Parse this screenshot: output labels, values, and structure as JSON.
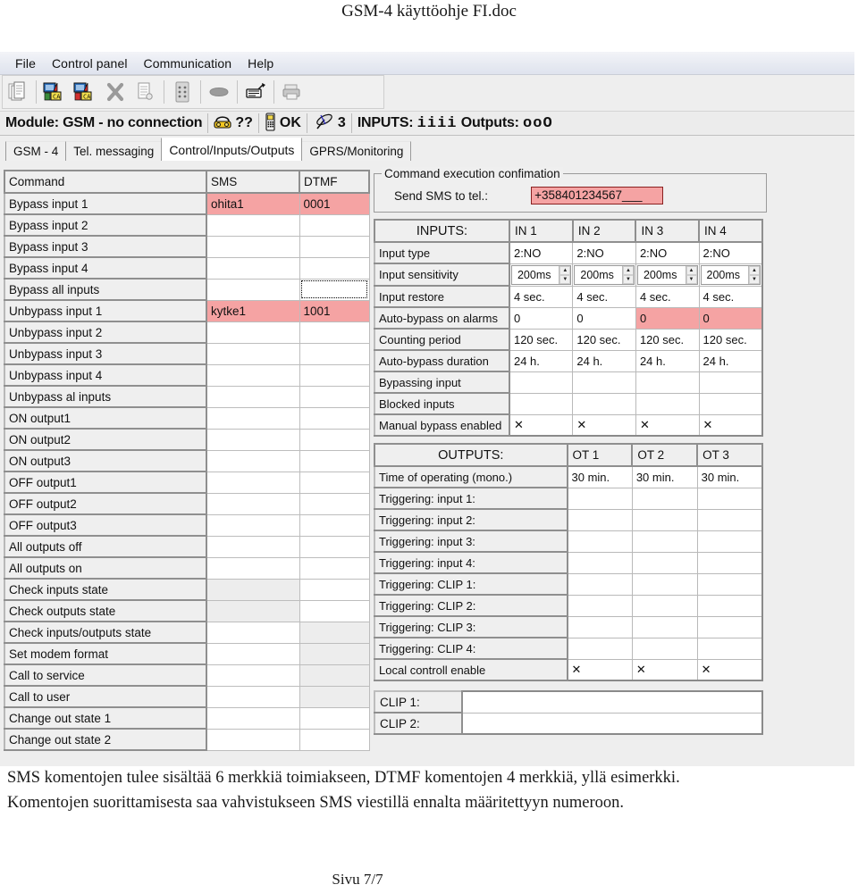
{
  "document": {
    "header_title": "GSM-4 käyttöohje FI.doc",
    "body_lines": [
      "SMS komentojen tulee sisältää 6 merkkiä toimiakseen, DTMF komentojen 4 merkkiä, yllä esimerkki.",
      "Komentojen suorittamisesta saa vahvistukseen SMS viestillä ennalta määritettyyn numeroon."
    ],
    "footer": "Sivu 7/7"
  },
  "app": {
    "menubar": [
      "File",
      "Control panel",
      "Communication",
      "Help"
    ],
    "toolbar": [
      {
        "name": "new-document-icon",
        "title": "New"
      },
      {
        "name": "download-from-module-icon",
        "title": "Read"
      },
      {
        "name": "upload-to-module-icon",
        "title": "Write"
      },
      {
        "name": "delete-icon",
        "title": "Delete"
      },
      {
        "name": "copy-document-icon",
        "title": "Copy"
      },
      {
        "name": "keypad-icon",
        "title": "Keypad"
      },
      {
        "name": "connect-icon",
        "title": "Connect"
      },
      {
        "name": "modem-icon",
        "title": "Modem"
      },
      {
        "name": "print-icon",
        "title": "Print"
      }
    ],
    "statusbar": {
      "module_label": "Module: GSM - no connection",
      "phone_status": "??",
      "sim_status": "OK",
      "signal_level": "3",
      "inputs_label": "INPUTS:",
      "inputs_state": "iiii",
      "outputs_label": "Outputs:",
      "outputs_state": "ooO"
    },
    "tabs": [
      {
        "label": "GSM - 4",
        "active": false
      },
      {
        "label": "Tel. messaging",
        "active": false
      },
      {
        "label": "Control/Inputs/Outputs",
        "active": true
      },
      {
        "label": "GPRS/Monitoring",
        "active": false
      }
    ]
  },
  "command_table": {
    "headers": [
      "Command",
      "SMS",
      "DTMF"
    ],
    "rows": [
      {
        "command": "Bypass input 1",
        "sms": "ohita1",
        "dtmf": "0001",
        "sms_state": "highlight",
        "dtmf_state": "highlight"
      },
      {
        "command": "Bypass input 2",
        "sms": "",
        "dtmf": "",
        "sms_state": "normal",
        "dtmf_state": "normal"
      },
      {
        "command": "Bypass input 3",
        "sms": "",
        "dtmf": "",
        "sms_state": "normal",
        "dtmf_state": "normal"
      },
      {
        "command": "Bypass input 4",
        "sms": "",
        "dtmf": "",
        "sms_state": "normal",
        "dtmf_state": "normal"
      },
      {
        "command": "Bypass all inputs",
        "sms": "",
        "dtmf": "",
        "sms_state": "normal",
        "dtmf_state": "focus"
      },
      {
        "command": "Unbypass input 1",
        "sms": "kytke1",
        "dtmf": "1001",
        "sms_state": "highlight",
        "dtmf_state": "highlight"
      },
      {
        "command": "Unbypass input 2",
        "sms": "",
        "dtmf": "",
        "sms_state": "normal",
        "dtmf_state": "normal"
      },
      {
        "command": "Unbypass input 3",
        "sms": "",
        "dtmf": "",
        "sms_state": "normal",
        "dtmf_state": "normal"
      },
      {
        "command": "Unbypass input 4",
        "sms": "",
        "dtmf": "",
        "sms_state": "normal",
        "dtmf_state": "normal"
      },
      {
        "command": "Unbypass al inputs",
        "sms": "",
        "dtmf": "",
        "sms_state": "normal",
        "dtmf_state": "normal"
      },
      {
        "command": "ON output1",
        "sms": "",
        "dtmf": "",
        "sms_state": "normal",
        "dtmf_state": "normal"
      },
      {
        "command": "ON output2",
        "sms": "",
        "dtmf": "",
        "sms_state": "normal",
        "dtmf_state": "normal"
      },
      {
        "command": "ON output3",
        "sms": "",
        "dtmf": "",
        "sms_state": "normal",
        "dtmf_state": "normal"
      },
      {
        "command": "OFF output1",
        "sms": "",
        "dtmf": "",
        "sms_state": "normal",
        "dtmf_state": "normal"
      },
      {
        "command": "OFF output2",
        "sms": "",
        "dtmf": "",
        "sms_state": "normal",
        "dtmf_state": "normal"
      },
      {
        "command": "OFF output3",
        "sms": "",
        "dtmf": "",
        "sms_state": "normal",
        "dtmf_state": "normal"
      },
      {
        "command": "All outputs off",
        "sms": "",
        "dtmf": "",
        "sms_state": "normal",
        "dtmf_state": "normal"
      },
      {
        "command": "All outputs on",
        "sms": "",
        "dtmf": "",
        "sms_state": "normal",
        "dtmf_state": "normal"
      },
      {
        "command": "Check inputs state",
        "sms": "",
        "dtmf": "",
        "sms_state": "dim",
        "dtmf_state": "normal"
      },
      {
        "command": "Check outputs state",
        "sms": "",
        "dtmf": "",
        "sms_state": "dim",
        "dtmf_state": "normal"
      },
      {
        "command": "Check inputs/outputs state",
        "sms": "",
        "dtmf": "",
        "sms_state": "normal",
        "dtmf_state": "dim"
      },
      {
        "command": "Set modem format",
        "sms": "",
        "dtmf": "",
        "sms_state": "normal",
        "dtmf_state": "dim"
      },
      {
        "command": "Call to service",
        "sms": "",
        "dtmf": "",
        "sms_state": "normal",
        "dtmf_state": "dim"
      },
      {
        "command": "Call to user",
        "sms": "",
        "dtmf": "",
        "sms_state": "normal",
        "dtmf_state": "dim"
      },
      {
        "command": "Change out state 1",
        "sms": "",
        "dtmf": "",
        "sms_state": "normal",
        "dtmf_state": "normal"
      },
      {
        "command": "Change out state 2",
        "sms": "",
        "dtmf": "",
        "sms_state": "normal",
        "dtmf_state": "normal"
      }
    ]
  },
  "confirmation": {
    "group_title": "Command execution confimation",
    "field_label": "Send SMS to tel.:",
    "tel_value": "+358401234567___"
  },
  "inputs_table": {
    "title": "INPUTS:",
    "columns": [
      "IN 1",
      "IN 2",
      "IN 3",
      "IN 4"
    ],
    "rows": [
      {
        "label": "Input type",
        "values": [
          "2:NO",
          "2:NO",
          "2:NO",
          "2:NO"
        ],
        "kind": "text",
        "states": [
          "normal",
          "normal",
          "normal",
          "normal"
        ]
      },
      {
        "label": "Input sensitivity",
        "values": [
          "200ms",
          "200ms",
          "200ms",
          "200ms"
        ],
        "kind": "spin",
        "states": [
          "normal",
          "normal",
          "normal",
          "normal"
        ]
      },
      {
        "label": "Input restore",
        "values": [
          "4 sec.",
          "4 sec.",
          "4 sec.",
          "4 sec."
        ],
        "kind": "text",
        "states": [
          "normal",
          "normal",
          "normal",
          "normal"
        ]
      },
      {
        "label": "Auto-bypass on alarms",
        "values": [
          "0",
          "0",
          "0",
          "0"
        ],
        "kind": "text",
        "states": [
          "normal",
          "normal",
          "highlight",
          "highlight"
        ]
      },
      {
        "label": "Counting period",
        "values": [
          "120 sec.",
          "120 sec.",
          "120 sec.",
          "120 sec."
        ],
        "kind": "text",
        "states": [
          "normal",
          "normal",
          "normal",
          "normal"
        ]
      },
      {
        "label": "Auto-bypass duration",
        "values": [
          "24 h.",
          "24 h.",
          "24 h.",
          "24 h."
        ],
        "kind": "text",
        "states": [
          "normal",
          "normal",
          "normal",
          "normal"
        ]
      },
      {
        "label": "Bypassing input",
        "values": [
          "",
          "",
          "",
          ""
        ],
        "kind": "text",
        "states": [
          "normal",
          "normal",
          "normal",
          "normal"
        ]
      },
      {
        "label": "Blocked inputs",
        "values": [
          "",
          "",
          "",
          ""
        ],
        "kind": "text",
        "states": [
          "normal",
          "normal",
          "normal",
          "normal"
        ]
      },
      {
        "label": "Manual bypass enabled",
        "values": [
          "✕",
          "✕",
          "✕",
          "✕"
        ],
        "kind": "text",
        "states": [
          "normal",
          "normal",
          "normal",
          "normal"
        ]
      }
    ]
  },
  "outputs_table": {
    "title": "OUTPUTS:",
    "columns": [
      "OT 1",
      "OT 2",
      "OT 3"
    ],
    "rows": [
      {
        "label": "Time of operating (mono.)",
        "values": [
          "30 min.",
          "30 min.",
          "30 min."
        ]
      },
      {
        "label": "Triggering: input 1:",
        "values": [
          "",
          "",
          ""
        ]
      },
      {
        "label": "Triggering: input 2:",
        "values": [
          "",
          "",
          ""
        ]
      },
      {
        "label": "Triggering: input 3:",
        "values": [
          "",
          "",
          ""
        ]
      },
      {
        "label": "Triggering: input 4:",
        "values": [
          "",
          "",
          ""
        ]
      },
      {
        "label": "Triggering: CLIP 1:",
        "values": [
          "",
          "",
          ""
        ]
      },
      {
        "label": "Triggering: CLIP 2:",
        "values": [
          "",
          "",
          ""
        ]
      },
      {
        "label": "Triggering: CLIP 3:",
        "values": [
          "",
          "",
          ""
        ]
      },
      {
        "label": "Triggering: CLIP 4:",
        "values": [
          "",
          "",
          ""
        ]
      },
      {
        "label": "Local controll enable",
        "values": [
          "✕",
          "✕",
          "✕"
        ]
      }
    ]
  },
  "clip_table": {
    "rows": [
      {
        "label": "CLIP 1:",
        "value": ""
      },
      {
        "label": "CLIP 2:",
        "value": ""
      }
    ]
  },
  "colors": {
    "highlight_pink": "#f5a3a3",
    "dim_grey": "#ededed",
    "panel_grey": "#efefef",
    "menubar_grey": "#e7eaf2"
  }
}
